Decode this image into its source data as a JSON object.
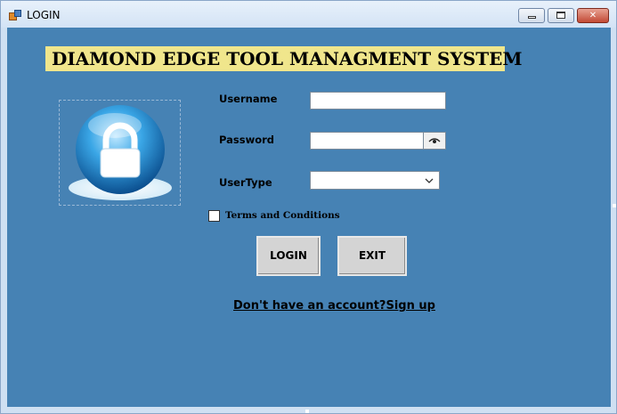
{
  "window": {
    "title": "LOGIN"
  },
  "header": {
    "banner": "DIAMOND EDGE TOOL MANAGMENT SYSTEM"
  },
  "form": {
    "username_label": "Username",
    "username_value": "",
    "password_label": "Password",
    "password_value": "",
    "usertype_label": "UserType",
    "usertype_value": "",
    "terms_label": "Terms and Conditions",
    "terms_checked": false
  },
  "buttons": {
    "login_label": "LOGIN",
    "exit_label": "EXIT"
  },
  "signup_link": "Don't have an account?Sign up",
  "icons": {
    "app": "app-icon",
    "logo": "lock-icon",
    "password_toggle": "eye-icon",
    "dropdown": "chevron-down-icon"
  },
  "colors": {
    "client_background": "#4682b4",
    "banner_background": "#f0e68c",
    "button_background": "#d4d4d4"
  }
}
